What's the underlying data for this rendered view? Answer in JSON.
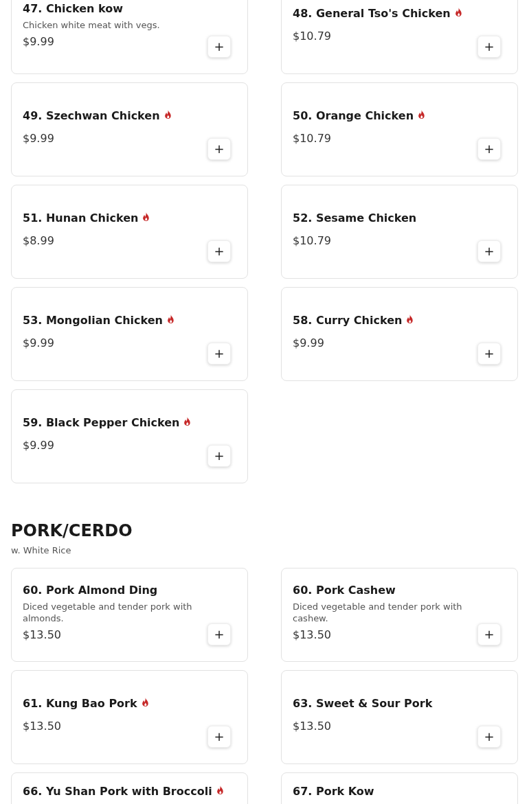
{
  "sections": [
    {
      "items": [
        {
          "name": "47. Chicken kow",
          "spicy": false,
          "description": "Chicken white meat with vegs.",
          "price": "$9.99",
          "button": "+"
        },
        {
          "name": "48. General Tso's Chicken",
          "spicy": true,
          "price": "$10.79",
          "button": "+"
        },
        {
          "name": "49. Szechwan Chicken",
          "spicy": true,
          "price": "$9.99",
          "button": "+"
        },
        {
          "name": "50. Orange Chicken",
          "spicy": true,
          "price": "$10.79",
          "button": "+"
        },
        {
          "name": "51. Hunan Chicken",
          "spicy": true,
          "price": "$8.99",
          "button": "+"
        },
        {
          "name": "52. Sesame Chicken",
          "spicy": false,
          "price": "$10.79",
          "button": "+"
        },
        {
          "name": "53. Mongolian Chicken",
          "spicy": true,
          "price": "$9.99",
          "button": "+"
        },
        {
          "name": "58. Curry Chicken",
          "spicy": true,
          "price": "$9.99",
          "button": "+"
        },
        {
          "name": "59. Black Pepper Chicken",
          "spicy": true,
          "price": "$9.99",
          "button": "+"
        }
      ]
    },
    {
      "title": "PORK/CERDO",
      "subtitle": "w. White Rice",
      "items": [
        {
          "name": "60. Pork Almond Ding",
          "spicy": false,
          "description": "Diced vegetable and tender pork with almonds.",
          "price": "$13.50",
          "button": "+"
        },
        {
          "name": "60. Pork Cashew",
          "spicy": false,
          "description": "Diced vegetable and tender pork with cashew.",
          "price": "$13.50",
          "button": "+"
        },
        {
          "name": "61. Kung Bao Pork",
          "spicy": true,
          "price": "$13.50",
          "button": "+"
        },
        {
          "name": "63. Sweet & Sour Pork",
          "spicy": false,
          "price": "$13.50",
          "button": "+"
        },
        {
          "name": "66. Yu Shan Pork with Broccoli",
          "spicy": true
        },
        {
          "name": "67. Pork Kow",
          "spicy": false
        }
      ]
    }
  ]
}
